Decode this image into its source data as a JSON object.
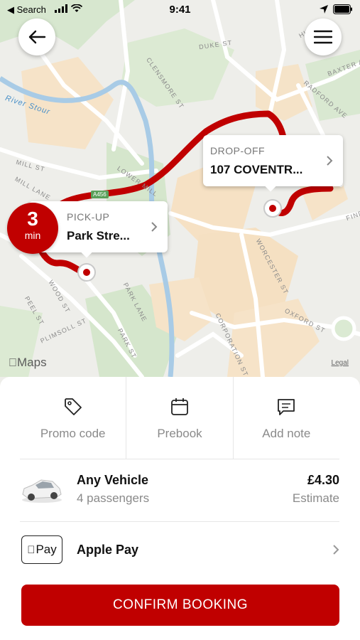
{
  "status_bar": {
    "back_app": "◀ Search",
    "time": "9:41"
  },
  "map": {
    "river_label": "River Stour",
    "road_badge": "A456",
    "maps_logo": "Maps",
    "legal": "Legal",
    "streets": [
      "DUKE ST",
      "CLENSMORE ST",
      "RADFORD AVE",
      "BAXTER A",
      "MILL ST",
      "MILL LANE",
      "LOWER MILL",
      "WOOD ST",
      "PEEL ST",
      "PLIMSOLL ST",
      "PARK LANE",
      "PARK ST",
      "WORCESTER ST",
      "OXFORD ST",
      "CORPORATION ST",
      "FIND",
      "HILL"
    ]
  },
  "pickup": {
    "label": "PICK-UP",
    "value": "Park Stre...",
    "eta_number": "3",
    "eta_unit": "min"
  },
  "dropoff": {
    "label": "DROP-OFF",
    "value": "107 COVENTR..."
  },
  "actions": [
    {
      "label": "Promo code",
      "icon": "tag-icon"
    },
    {
      "label": "Prebook",
      "icon": "calendar-icon"
    },
    {
      "label": "Add note",
      "icon": "note-icon"
    }
  ],
  "vehicle": {
    "name": "Any Vehicle",
    "passengers": "4 passengers",
    "price": "£4.30",
    "price_note": "Estimate"
  },
  "payment": {
    "badge": "Pay",
    "method": "Apple Pay"
  },
  "confirm_label": "CONFIRM BOOKING",
  "colors": {
    "brand": "#c00000",
    "route": "#c00000"
  }
}
